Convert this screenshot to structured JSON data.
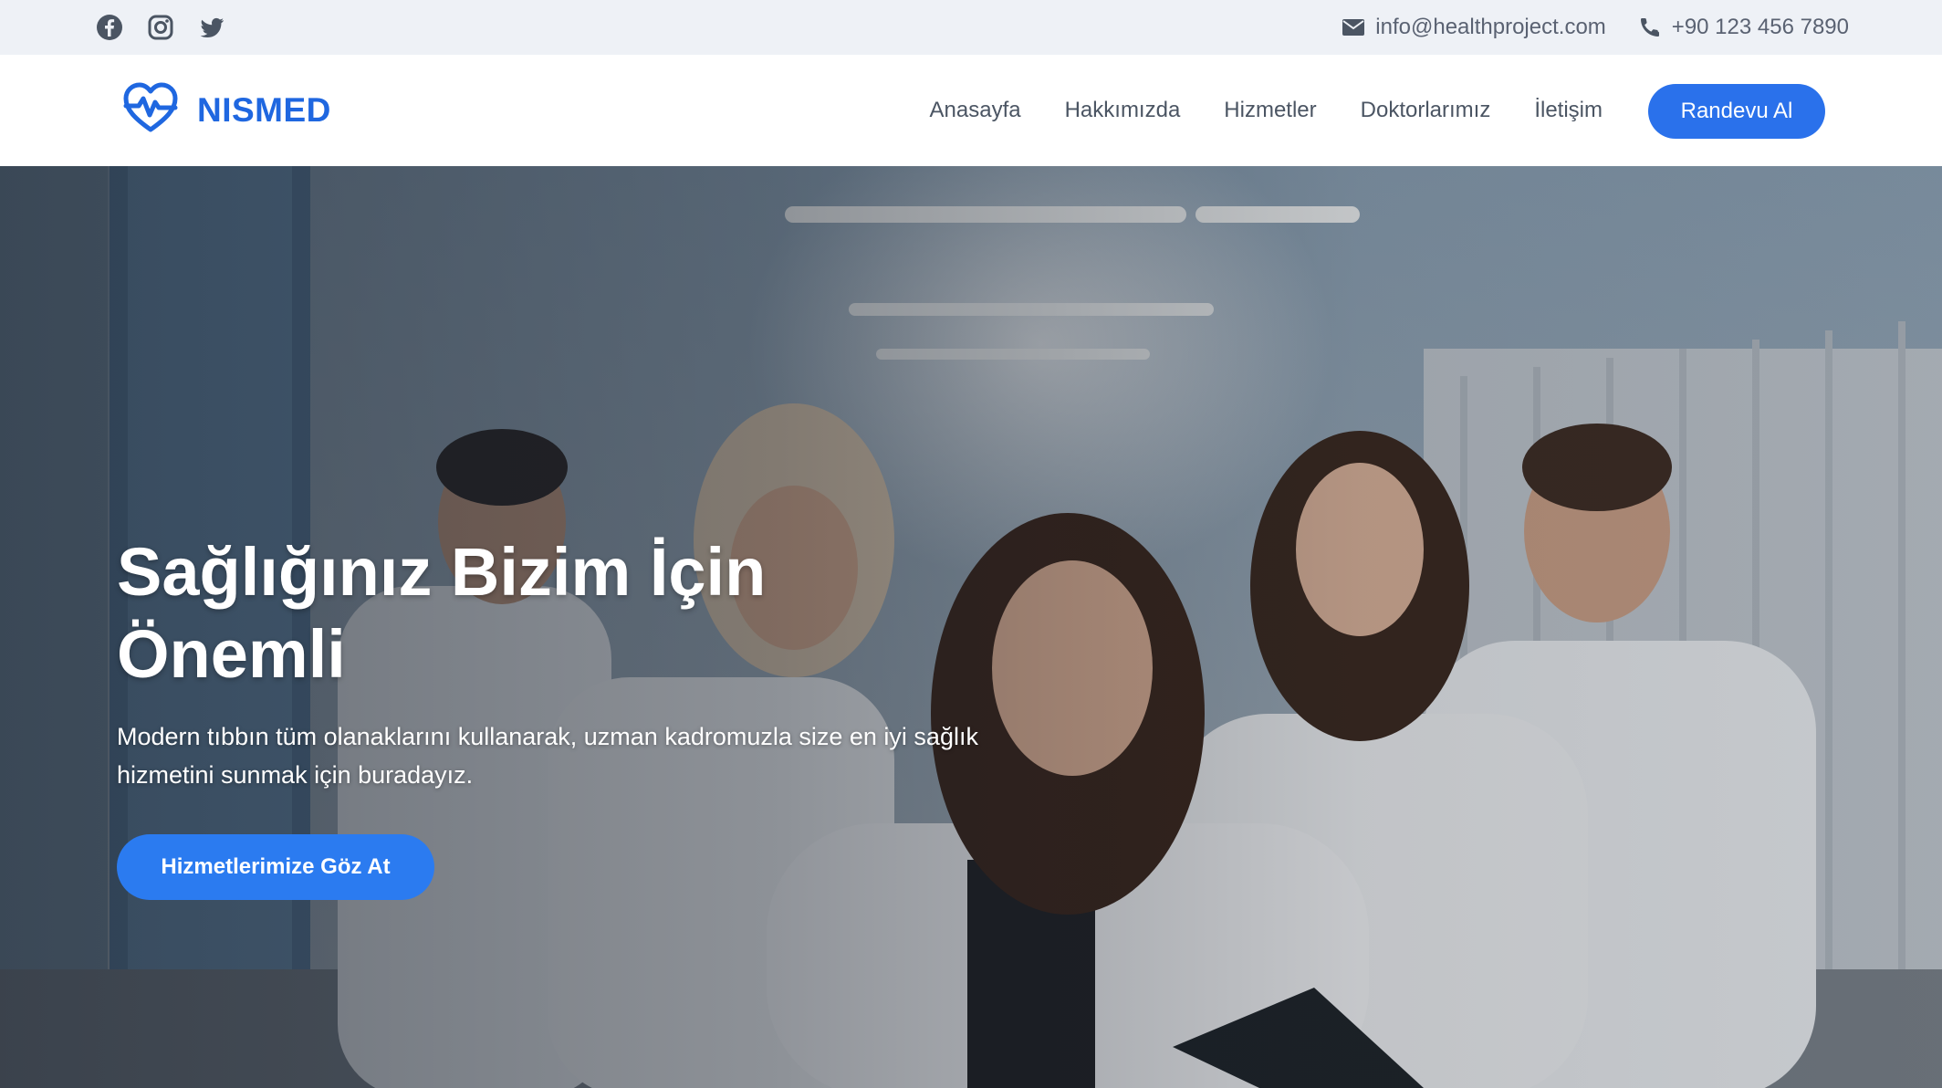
{
  "topbar": {
    "social_icons": [
      "facebook-icon",
      "instagram-icon",
      "twitter-icon"
    ],
    "email": "info@healthproject.com",
    "phone": "+90 123 456 7890"
  },
  "navbar": {
    "brand": "NISMED",
    "links": [
      "Anasayfa",
      "Hakkımızda",
      "Hizmetler",
      "Doktorlarımız",
      "İletişim"
    ],
    "cta_label": "Randevu Al"
  },
  "hero": {
    "title_line1": "Sağlığınız Bizim İçin",
    "title_line2": "Önemli",
    "subtitle": "Modern tıbbın tüm olanaklarını kullanarak, uzman kadromuzla size en iyi sağlık hizmetini sunmak için buradayız.",
    "button_label": "Hizmetlerimize Göz At"
  },
  "colors": {
    "brand": "#1f67e0",
    "cta": "#2a71eb",
    "topbar_bg": "#eef1f6",
    "text_muted": "#4b5563"
  }
}
